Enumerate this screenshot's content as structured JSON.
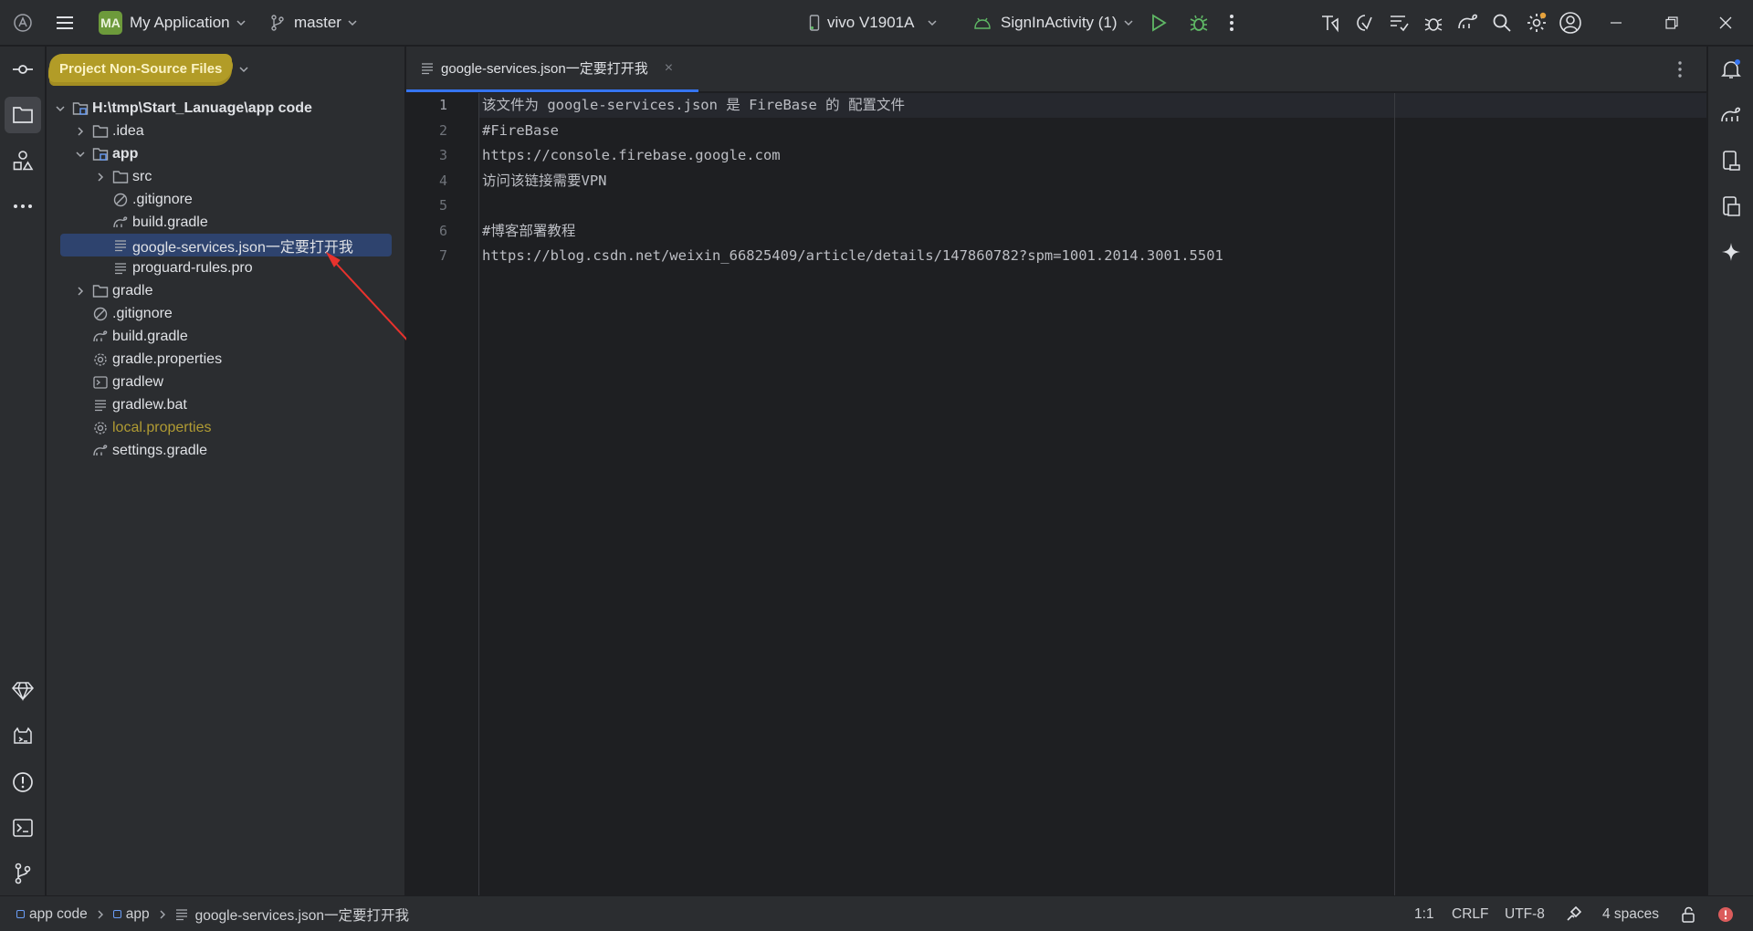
{
  "titlebar": {
    "project_badge": "MA",
    "project_name": "My Application",
    "branch": "master",
    "device": "vivo V1901A",
    "run_config": "SignInActivity (1)"
  },
  "project_panel": {
    "view_mode": "Project Non-Source Files",
    "tree": [
      {
        "label": "H:\\tmp\\Start_Lanuage\\app code",
        "depth": 0,
        "type": "module-folder",
        "arrow": "down",
        "bold": true
      },
      {
        "label": ".idea",
        "depth": 1,
        "type": "folder",
        "arrow": "right"
      },
      {
        "label": "app",
        "depth": 1,
        "type": "module-folder",
        "arrow": "down",
        "bold": true
      },
      {
        "label": "src",
        "depth": 2,
        "type": "folder",
        "arrow": "right"
      },
      {
        "label": ".gitignore",
        "depth": 2,
        "type": "ignore"
      },
      {
        "label": "build.gradle",
        "depth": 2,
        "type": "gradle"
      },
      {
        "label": "google-services.json一定要打开我",
        "depth": 2,
        "type": "text",
        "selected": true
      },
      {
        "label": "proguard-rules.pro",
        "depth": 2,
        "type": "text"
      },
      {
        "label": "gradle",
        "depth": 1,
        "type": "folder",
        "arrow": "right"
      },
      {
        "label": ".gitignore",
        "depth": 1,
        "type": "ignore"
      },
      {
        "label": "build.gradle",
        "depth": 1,
        "type": "gradle"
      },
      {
        "label": "gradle.properties",
        "depth": 1,
        "type": "settings"
      },
      {
        "label": "gradlew",
        "depth": 1,
        "type": "terminal"
      },
      {
        "label": "gradlew.bat",
        "depth": 1,
        "type": "text"
      },
      {
        "label": "local.properties",
        "depth": 1,
        "type": "settings",
        "warn": true
      },
      {
        "label": "settings.gradle",
        "depth": 1,
        "type": "gradle"
      }
    ]
  },
  "editor": {
    "tab_label": "google-services.json一定要打开我",
    "tab_close": "×",
    "lines": [
      {
        "num": "1",
        "text": "该文件为 google-services.json 是 FireBase 的 配置文件"
      },
      {
        "num": "2",
        "text": "#FireBase"
      },
      {
        "num": "3",
        "text": "https://console.firebase.google.com"
      },
      {
        "num": "4",
        "text": "访问该链接需要VPN"
      },
      {
        "num": "5",
        "text": ""
      },
      {
        "num": "6",
        "text": "#博客部署教程"
      },
      {
        "num": "7",
        "text": "https://blog.csdn.net/weixin_66825409/article/details/147860782?spm=1001.2014.3001.5501"
      }
    ]
  },
  "statusbar": {
    "breadcrumb": [
      "app code",
      "app",
      "google-services.json一定要打开我"
    ],
    "position": "1:1",
    "line_sep": "CRLF",
    "encoding": "UTF-8",
    "indent": "4 spaces"
  },
  "colors": {
    "accent": "#3574f0",
    "highlight": "#b29c27",
    "selection": "#2e436e",
    "run_green": "#5fb865",
    "error_red": "#db5c5c"
  }
}
